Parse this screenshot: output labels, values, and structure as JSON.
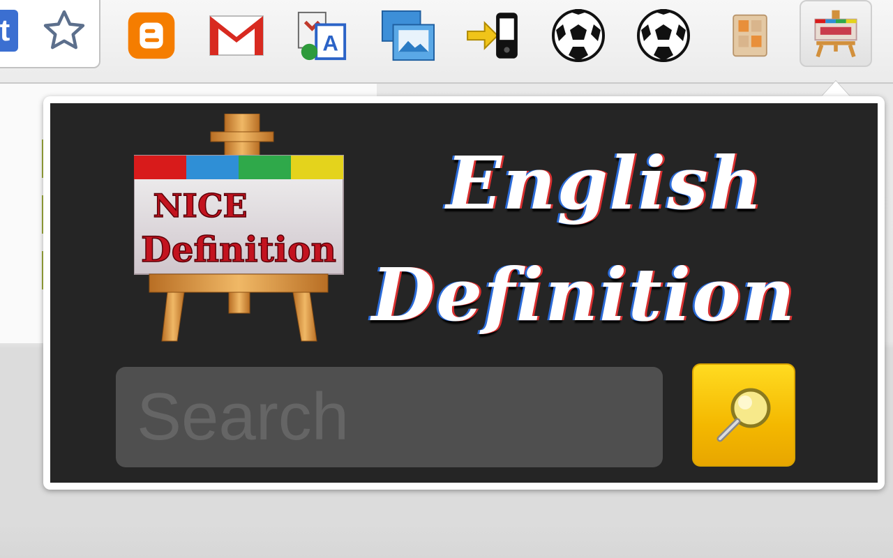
{
  "toolbar": {
    "extensions": [
      {
        "name": "bookmark-star-icon"
      },
      {
        "name": "blogger-icon"
      },
      {
        "name": "gmail-icon"
      },
      {
        "name": "translate-icon"
      },
      {
        "name": "photo-viewer-icon"
      },
      {
        "name": "send-to-phone-icon"
      },
      {
        "name": "soccer-ball-icon"
      },
      {
        "name": "soccer-ball-icon"
      },
      {
        "name": "calculator-icon"
      },
      {
        "name": "english-definition-icon"
      }
    ],
    "omnibox_end_letter": "t"
  },
  "popup": {
    "logo": {
      "line1": "NICE",
      "line2": "Definition",
      "stripe_colors": [
        "#d81b1b",
        "#2f8fd6",
        "#2fa94a",
        "#e4d31c"
      ]
    },
    "title_line1": "English",
    "title_line2": "Definition",
    "search": {
      "value": "",
      "placeholder": "Search"
    },
    "search_button_icon": "magnifier-icon"
  },
  "colors": {
    "popup_bg": "#252525",
    "search_button": "#f4b800",
    "input_bg": "#4f4f4f"
  }
}
